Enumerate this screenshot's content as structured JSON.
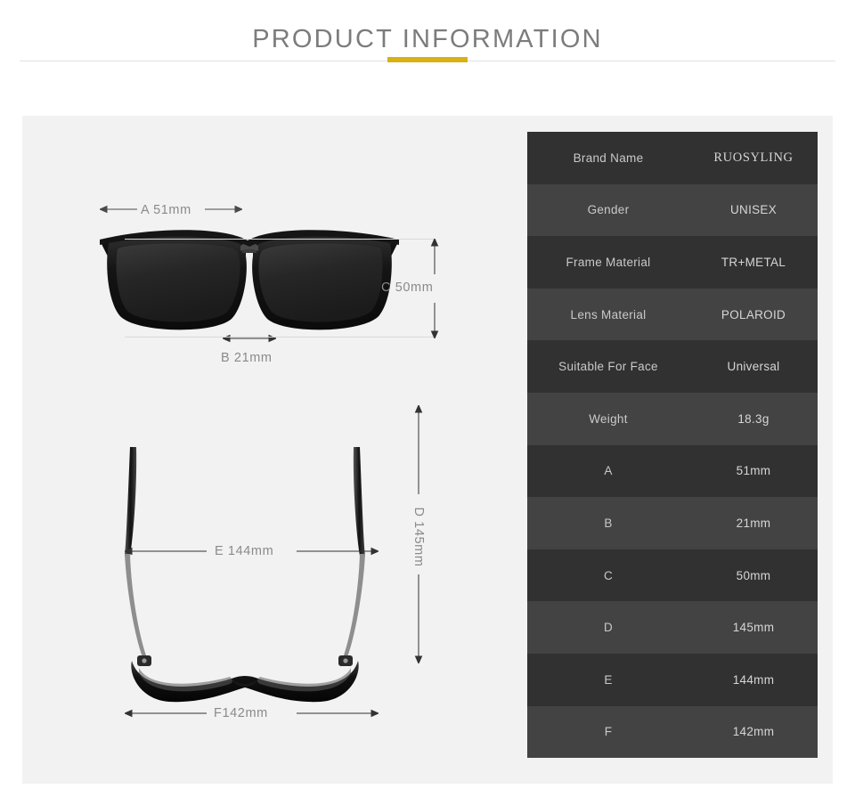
{
  "header": {
    "title": "PRODUCT INFORMATION",
    "accent_color": "#d8b115",
    "title_color": "#7c7c7c"
  },
  "panel": {
    "background_color": "#f2f2f2"
  },
  "diagram": {
    "front_view": {
      "name": "sunglasses-front-view",
      "labels": {
        "width": "A 51mm",
        "bridge": "B 21mm",
        "height": "C 50mm"
      }
    },
    "top_view": {
      "name": "sunglasses-top-view",
      "labels": {
        "temple_length": "D 145mm",
        "temple_spread": "E 144mm",
        "frame_width": "F142mm"
      }
    }
  },
  "spec_table": {
    "row_color_odd": "#313131",
    "row_color_even": "#434343",
    "rows": [
      {
        "label": "Brand Name",
        "value": "RUOSYLING",
        "value_style": "serif"
      },
      {
        "label": "Gender",
        "value": "UNISEX"
      },
      {
        "label": "Frame Material",
        "value": "TR+METAL"
      },
      {
        "label": "Lens Material",
        "value": "POLAROID"
      },
      {
        "label": "Suitable For Face",
        "value": "Universal"
      },
      {
        "label": "Weight",
        "value": "18.3g"
      },
      {
        "label": "A",
        "value": "51mm"
      },
      {
        "label": "B",
        "value": "21mm"
      },
      {
        "label": "C",
        "value": "50mm"
      },
      {
        "label": "D",
        "value": "145mm"
      },
      {
        "label": "E",
        "value": "144mm"
      },
      {
        "label": "F",
        "value": "142mm"
      }
    ]
  }
}
